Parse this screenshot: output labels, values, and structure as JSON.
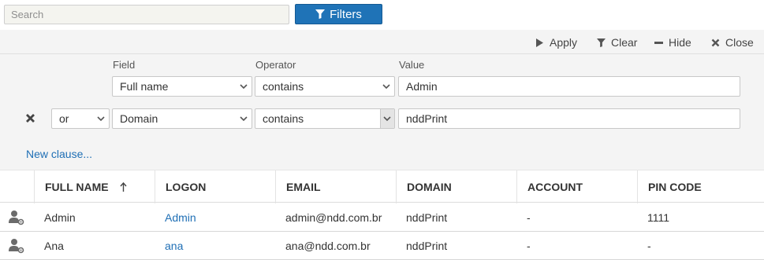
{
  "search": {
    "placeholder": "Search",
    "value": ""
  },
  "filters_button": {
    "label": "Filters",
    "icon": "funnel-icon"
  },
  "filter_actions": [
    {
      "label": "Apply",
      "icon": "play-icon"
    },
    {
      "label": "Clear",
      "icon": "funnel-icon"
    },
    {
      "label": "Hide",
      "icon": "minus-icon"
    },
    {
      "label": "Close",
      "icon": "close-icon"
    }
  ],
  "filter_columns": {
    "field": "Field",
    "operator": "Operator",
    "value": "Value"
  },
  "clauses": [
    {
      "field": "Full name",
      "operator": "contains",
      "value": "Admin"
    },
    {
      "connector": "or",
      "field": "Domain",
      "operator": "contains",
      "value": "nddPrint"
    }
  ],
  "new_clause_label": "New clause...",
  "table": {
    "columns": [
      "FULL NAME",
      "LOGON",
      "EMAIL",
      "DOMAIN",
      "ACCOUNT",
      "PIN CODE"
    ],
    "sort": {
      "column": "FULL NAME",
      "direction": "ascending"
    },
    "rows": [
      {
        "full_name": "Admin",
        "logon": "Admin",
        "email": "admin@ndd.com.br",
        "domain": "nddPrint",
        "account": "-",
        "pin_code": "1111"
      },
      {
        "full_name": "Ana",
        "logon": "ana",
        "email": "ana@ndd.com.br",
        "domain": "nddPrint",
        "account": "-",
        "pin_code": "-"
      }
    ]
  },
  "colors": {
    "accent": "#1f73b7",
    "link": "#1f6fb5",
    "panel_bg": "#f4f4f4"
  }
}
